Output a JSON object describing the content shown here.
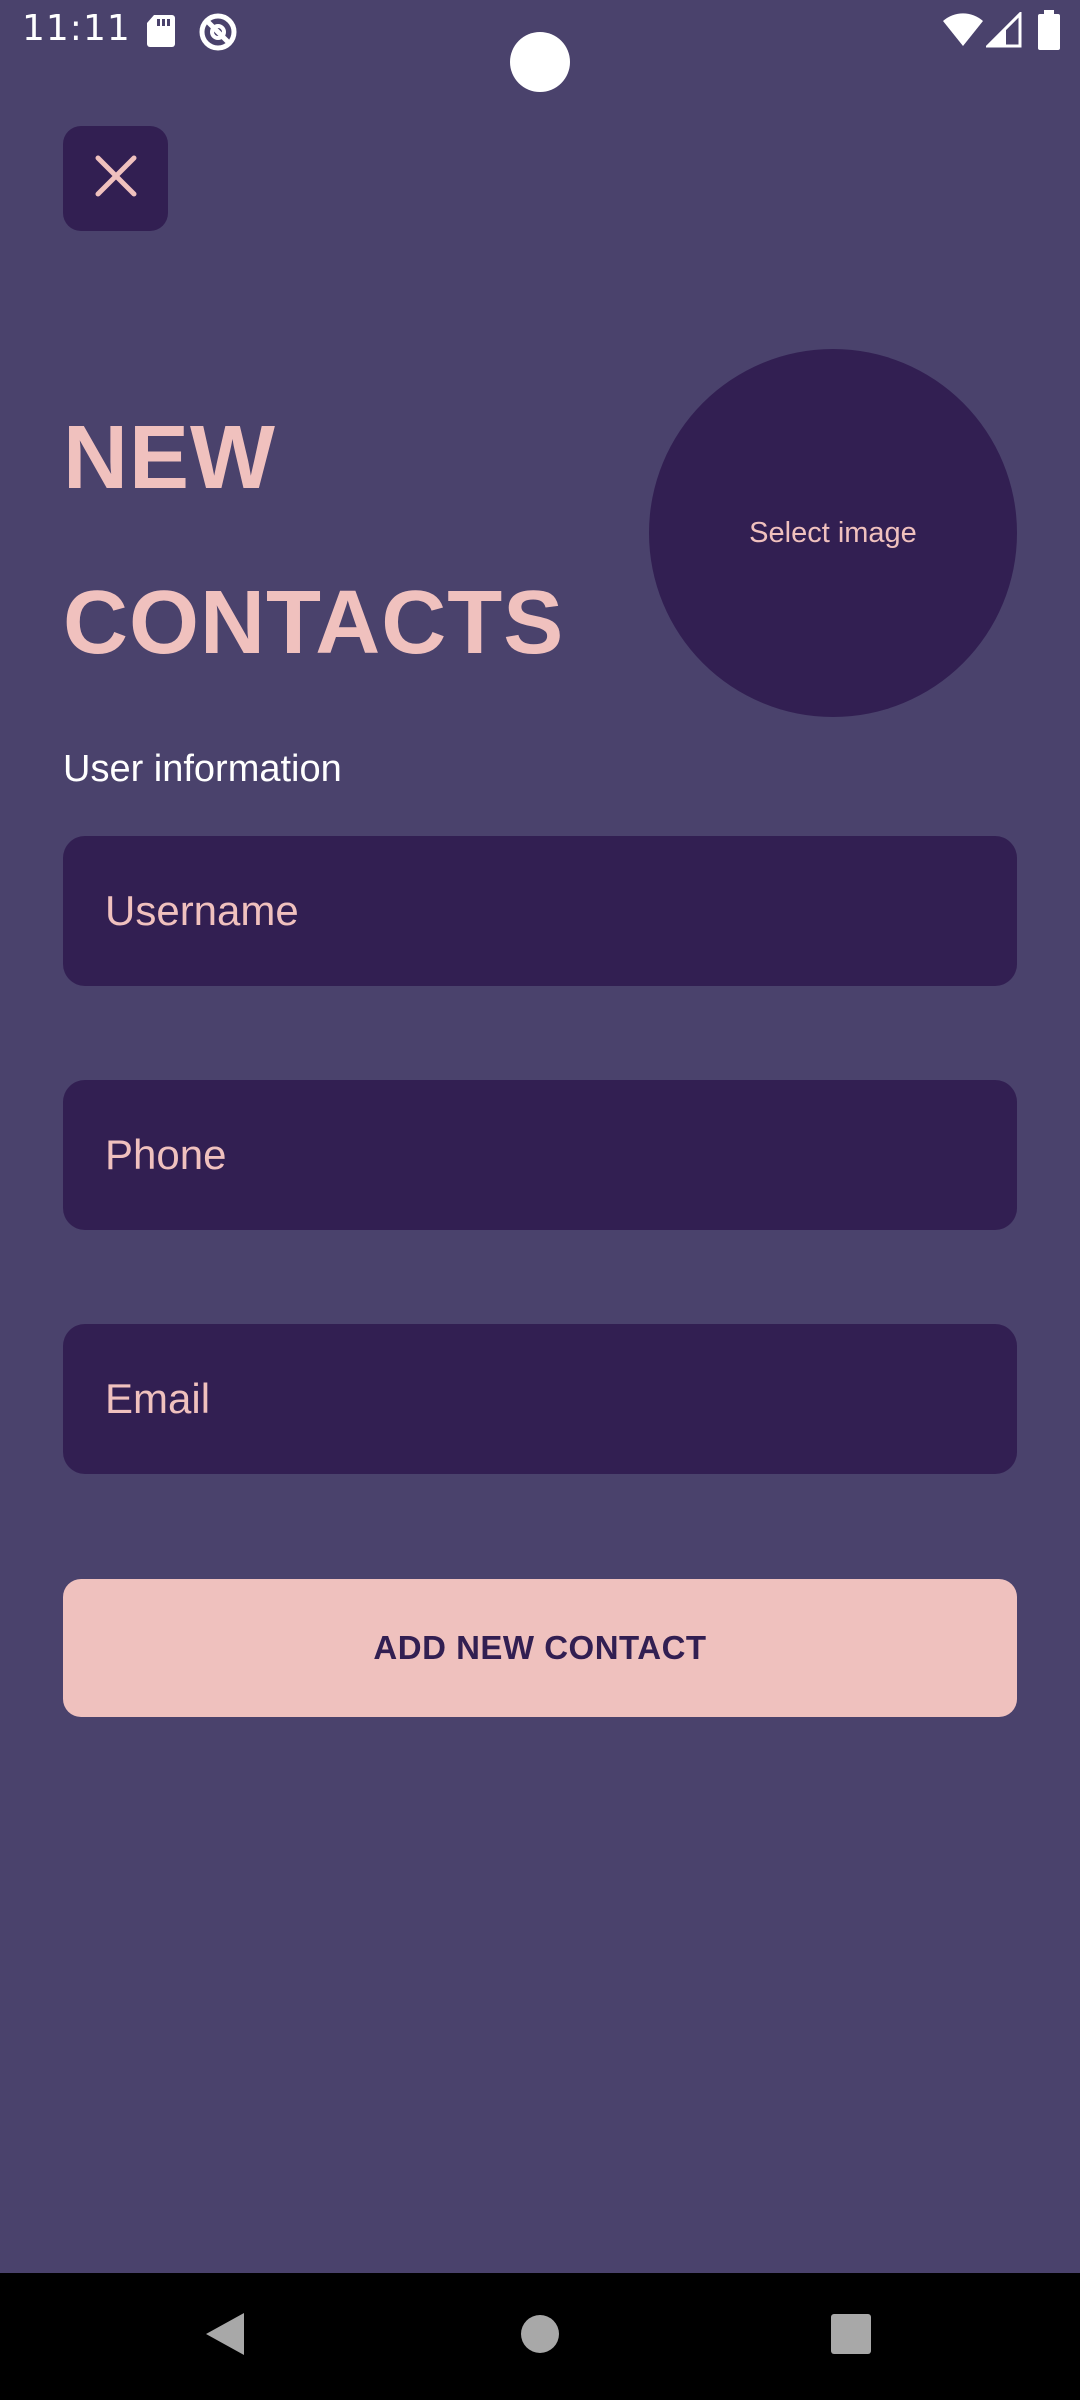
{
  "status_bar": {
    "time": "11:11",
    "left_icons": [
      "sd-card-icon",
      "no-disturb-icon"
    ],
    "right_icons": [
      "wifi-icon",
      "signal-icon",
      "battery-icon"
    ]
  },
  "header": {
    "close_icon": "close-icon",
    "title_line1": "NEW",
    "title_line2": "CONTACTS"
  },
  "avatar_picker": {
    "label": "Select image"
  },
  "form": {
    "section_label": "User information",
    "fields": [
      {
        "name": "username",
        "placeholder": "Username",
        "value": ""
      },
      {
        "name": "phone",
        "placeholder": "Phone",
        "value": ""
      },
      {
        "name": "email",
        "placeholder": "Email",
        "value": ""
      }
    ],
    "submit_label": "ADD NEW CONTACT"
  },
  "nav_bar": {
    "buttons": [
      "back-icon",
      "home-icon",
      "recents-icon"
    ]
  },
  "colors": {
    "background": "#4a426c",
    "surface": "#321f52",
    "accent": "#f0c1be",
    "button_bg": "#efc1be",
    "text_white": "#ffffff"
  }
}
